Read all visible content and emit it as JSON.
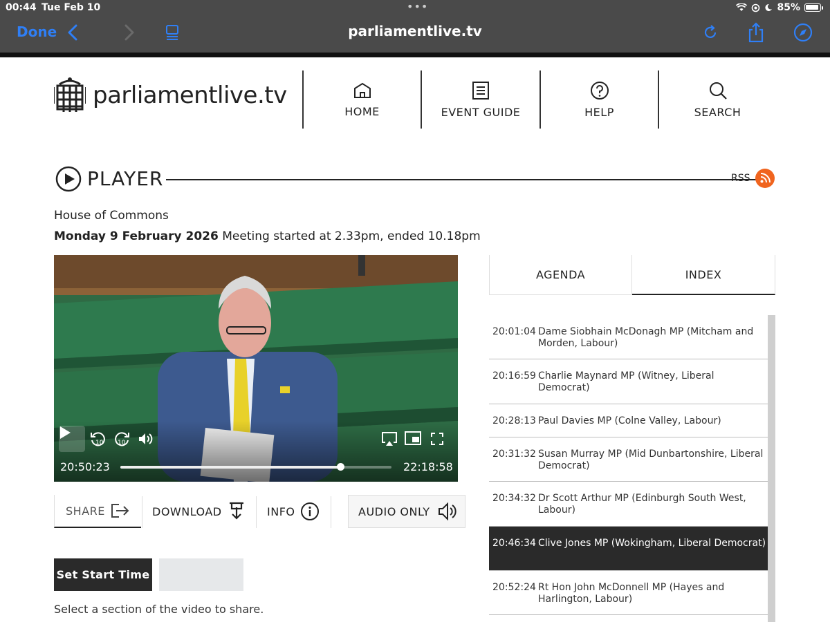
{
  "status": {
    "time": "00:44",
    "date": "Tue Feb 10",
    "battery": "85%"
  },
  "browser": {
    "done": "Done",
    "url": "parliamentlive.tv"
  },
  "site": {
    "logo_text": "parliamentlive.tv",
    "nav": [
      {
        "label": "HOME",
        "icon": "home-icon"
      },
      {
        "label": "EVENT GUIDE",
        "icon": "event-guide-icon"
      },
      {
        "label": "HELP",
        "icon": "help-icon"
      },
      {
        "label": "SEARCH",
        "icon": "search-icon"
      }
    ]
  },
  "player": {
    "title": "PLAYER",
    "rss": "RSS",
    "house": "House of Commons",
    "date": "Monday 9 February 2026",
    "meeting": "Meeting started at 2.33pm, ended 10.18pm",
    "current_time": "20:50:23",
    "end_time": "22:18:58",
    "progress": 0.81
  },
  "actions": {
    "share": "SHARE",
    "download": "DOWNLOAD",
    "info": "INFO",
    "audio_only": "AUDIO ONLY"
  },
  "clip": {
    "set_start": "Set Start Time",
    "hint": "Select a section of the video to share."
  },
  "tabs": {
    "agenda": "AGENDA",
    "index": "INDEX"
  },
  "index": [
    {
      "time": "20:01:04",
      "name": "Dame Siobhain McDonagh MP (Mitcham and Morden, Labour)"
    },
    {
      "time": "20:16:59",
      "name": "Charlie Maynard MP (Witney, Liberal Democrat)"
    },
    {
      "time": "20:28:13",
      "name": "Paul Davies MP (Colne Valley, Labour)"
    },
    {
      "time": "20:31:32",
      "name": "Susan Murray MP (Mid Dunbartonshire, Liberal Democrat)"
    },
    {
      "time": "20:34:32",
      "name": "Dr Scott Arthur MP (Edinburgh South West, Labour)"
    },
    {
      "time": "20:46:34",
      "name": "Clive Jones MP (Wokingham, Liberal Democrat)",
      "active": true
    },
    {
      "time": "20:52:24",
      "name": "Rt Hon John McDonnell MP (Hayes and Harlington, Labour)"
    }
  ]
}
